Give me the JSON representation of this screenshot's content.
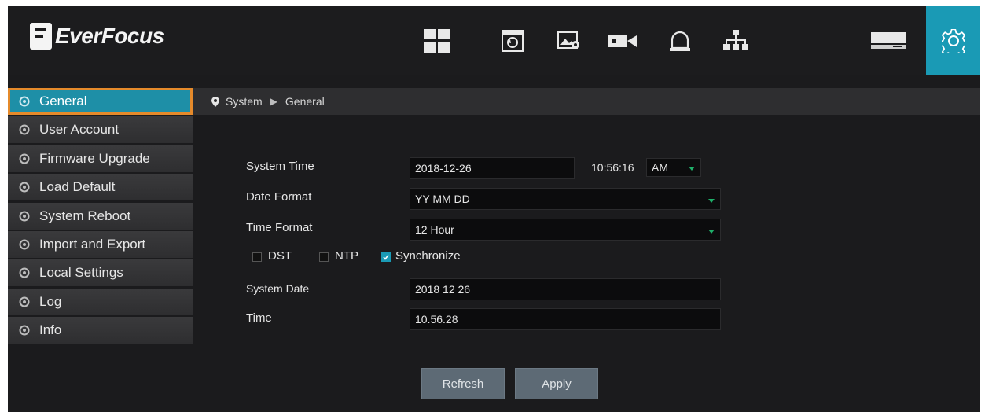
{
  "brand": {
    "name": "EverFocus"
  },
  "nav": {
    "icons": [
      {
        "name": "layout-grid-icon",
        "active": false
      },
      {
        "name": "playback-icon",
        "active": false
      },
      {
        "name": "image-settings-icon",
        "active": false
      },
      {
        "name": "camera-icon",
        "active": false
      },
      {
        "name": "alarm-icon",
        "active": false
      },
      {
        "name": "network-icon",
        "active": false
      },
      {
        "name": "storage-icon",
        "active": false
      },
      {
        "name": "settings-gear-icon",
        "active": true
      }
    ]
  },
  "sidebar": {
    "items": [
      {
        "label": "General",
        "active": true
      },
      {
        "label": "User Account"
      },
      {
        "label": "Firmware Upgrade"
      },
      {
        "label": "Load Default"
      },
      {
        "label": "System Reboot"
      },
      {
        "label": "Import and Export"
      },
      {
        "label": "Local Settings"
      },
      {
        "label": "Log"
      },
      {
        "label": "Info"
      }
    ]
  },
  "breadcrumb": {
    "root": "System",
    "current": "General"
  },
  "form": {
    "system_time_label": "System Time",
    "system_time_date": "2018-12-26",
    "system_time_time": "10:56:16",
    "ampm": "AM",
    "date_format_label": "Date Format",
    "date_format_value": "YY MM DD",
    "time_format_label": "Time Format",
    "time_format_value": "12 Hour",
    "dst_label": "DST",
    "ntp_label": "NTP",
    "sync_label": "Synchronize",
    "system_date_label": "System Date",
    "system_date_value": "2018 12 26",
    "time_label": "Time",
    "time_value": "10.56.28"
  },
  "buttons": {
    "refresh": "Refresh",
    "apply": "Apply"
  },
  "colors": {
    "accent": "#1a9ab5",
    "highlight": "#e58a2b",
    "dropdown_arrow": "#1fb06a"
  }
}
